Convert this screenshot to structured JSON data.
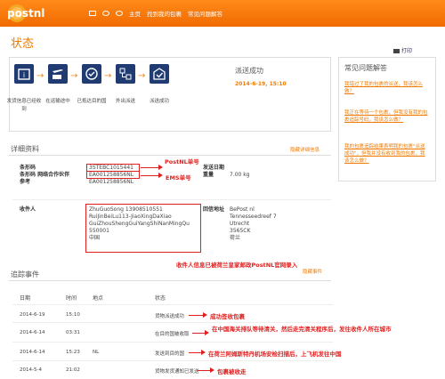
{
  "brand": "postnl",
  "nav": {
    "home": "主页",
    "find": "找到我的包裹",
    "faq": "常见问题解答"
  },
  "page_title": "状态",
  "print_label": "打印",
  "status": {
    "steps": [
      {
        "label": "发货信息已经收到",
        "icon": "box-info-icon"
      },
      {
        "label": "在运输途中",
        "icon": "plane-truck-icon"
      },
      {
        "label": "已抵达目的国",
        "icon": "globe-icon"
      },
      {
        "label": "外出派送",
        "icon": "sort-icon"
      },
      {
        "label": "派送成功",
        "icon": "check-icon"
      }
    ],
    "result": "派送成功",
    "datetime": "2014-6-19, 15:10"
  },
  "faq": {
    "title": "常见问题解答",
    "questions": [
      "我错过了我的包裹的派送，我该怎么做？",
      "我正在等待一个包裹，但我没有我的包裹追踪号码，我该怎么做？",
      "我的包裹追踪结果表明我的包裹\"派送成功\"，但我并没有收到我的包裹，我该怎么做？"
    ]
  },
  "details": {
    "title": "详细资料",
    "hide": "隐藏详细信息",
    "barcode_label": "条形码",
    "partner_label": "条形码 网络合作伙伴",
    "ref_label": "参考",
    "barcode": "3STEBC1015441",
    "partner_barcode": "EA001258856NL",
    "ref": "EA001258856NL",
    "send_date_label": "发送日期",
    "weight_label": "重量",
    "weight": "7.00 kg",
    "recipient_label": "收件人",
    "recipient_lines": [
      "ZhuGuoSong 13908510551",
      "RuiJinBeiLu113-JiaoXingDaXiao",
      "GuiZhouShengGuiYangShiNanMingQu",
      "550001",
      "中国"
    ],
    "return_label": "回信地址",
    "return_lines": [
      "BePost nl",
      "Tennesseedreef 7",
      "Utrecht",
      "3565CK",
      "荷兰"
    ],
    "hide2": "隐藏事件"
  },
  "tracking": {
    "title": "追踪事件",
    "headers": [
      "日期",
      "时间",
      "地点",
      "状态"
    ],
    "rows": [
      {
        "date": "2014-6-19",
        "time": "15:10",
        "place": "",
        "status": "货物派送成功"
      },
      {
        "date": "2014-6-14",
        "time": "03:31",
        "place": "",
        "status": "在目的国被收取"
      },
      {
        "date": "2014-6-14",
        "time": "15:23",
        "place": "NL",
        "status": "发送到目的国"
      },
      {
        "date": "2014-5-4",
        "time": "21:02",
        "place": "",
        "status": "货物发货通知已发送"
      }
    ]
  },
  "annotations": {
    "postnl": "PostNL单号",
    "ems": "EMS单号",
    "recipient": "收件人信息已被荷兰皇家邮政PostNL官网录入",
    "row1": "成功签收包裹",
    "row2": "在中国海关排队等待清关，然后走完清关程序后，发往收件人所在城市",
    "row3": "在荷兰阿姆斯特丹机场安检扫描后，上飞机发往中国",
    "row4": "包裹被收走"
  },
  "colors": {
    "orange": "#f07a00",
    "navy": "#203a72",
    "red": "#e02020"
  }
}
